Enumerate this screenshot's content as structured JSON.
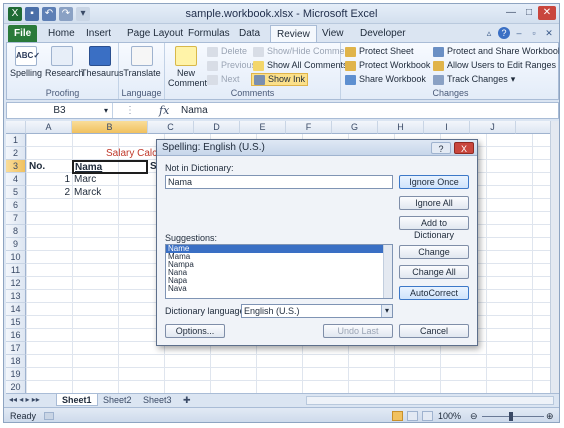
{
  "window": {
    "title": "sample.workbook.xlsx - Microsoft Excel"
  },
  "tabs": [
    "File",
    "Home",
    "Insert",
    "Page Layout",
    "Formulas",
    "Data",
    "Review",
    "View",
    "Developer"
  ],
  "ribbon": {
    "proofing": {
      "label": "Proofing",
      "spelling": "Spelling",
      "research": "Research",
      "thesaurus": "Thesaurus"
    },
    "language": {
      "label": "Language",
      "translate": "Translate"
    },
    "comments": {
      "label": "Comments",
      "new_comment": "New Comment",
      "delete": "Delete",
      "previous": "Previous",
      "next": "Next",
      "show_hide": "Show/Hide Comment",
      "show_all": "Show All Comments",
      "show_ink": "Show Ink"
    },
    "changes": {
      "label": "Changes",
      "protect_sheet": "Protect Sheet",
      "protect_workbook": "Protect Workbook",
      "share_workbook": "Share Workbook",
      "protect_share": "Protect and Share Workbook",
      "allow_users": "Allow Users to Edit Ranges",
      "track_changes": "Track Changes"
    }
  },
  "formula_bar": {
    "name_box": "B3",
    "fx": "fx",
    "value": "Nama"
  },
  "grid": {
    "columns": [
      "A",
      "B",
      "C",
      "D",
      "E",
      "F",
      "G",
      "H",
      "I",
      "J"
    ],
    "rows": [
      "1",
      "2",
      "3",
      "4",
      "5",
      "6",
      "7",
      "8",
      "9",
      "10",
      "11",
      "12",
      "13",
      "14",
      "15",
      "16",
      "17",
      "18",
      "19",
      "20"
    ],
    "cells": {
      "C2": "Salary Calcu",
      "A3": "No.",
      "B3": "Nama",
      "C3": "Sa",
      "A4": "1",
      "B4": "Marc",
      "A5": "2",
      "B5": "Marck"
    }
  },
  "sheets": [
    "Sheet1",
    "Sheet2",
    "Sheet3"
  ],
  "status": {
    "ready": "Ready",
    "zoom": "100%"
  },
  "dialog": {
    "title": "Spelling: English (U.S.)",
    "help": "?",
    "close": "X",
    "not_in_dictionary_label": "Not in Dictionary:",
    "not_in_dictionary_value": "Nama",
    "suggestions_label": "Suggestions:",
    "suggestions": [
      "Name",
      "Mama",
      "Nampa",
      "Nana",
      "Napa",
      "Nava"
    ],
    "dictionary_language_label": "Dictionary language:",
    "dictionary_language_value": "English (U.S.)",
    "buttons": {
      "ignore_once": "Ignore Once",
      "ignore_all": "Ignore All",
      "add_to_dictionary": "Add to Dictionary",
      "change": "Change",
      "change_all": "Change All",
      "autocorrect": "AutoCorrect",
      "options": "Options...",
      "undo_last": "Undo Last",
      "cancel": "Cancel"
    }
  },
  "colors": {
    "file_tab": "#2a7a3a",
    "selection": "#f1c15f",
    "dialog_focus": "#3c78c8",
    "title_red": "#c0392b"
  }
}
